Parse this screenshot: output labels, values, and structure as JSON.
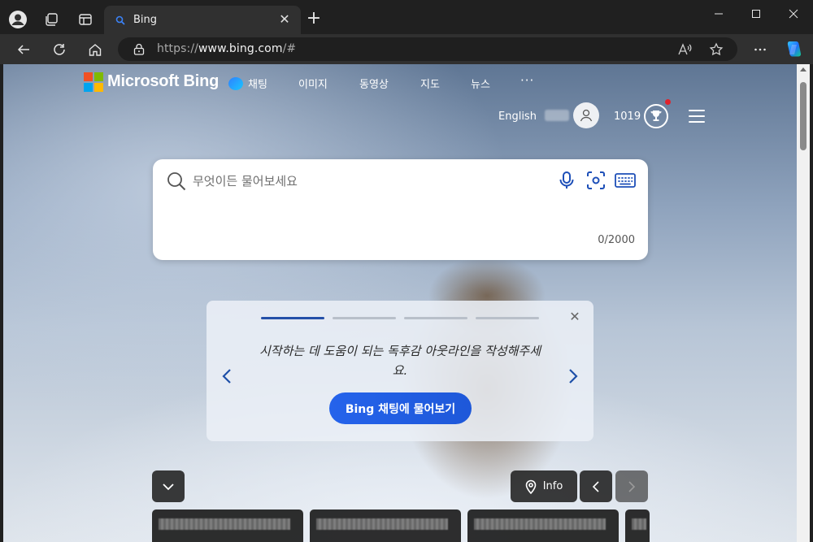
{
  "browser": {
    "tab": {
      "title": "Bing"
    },
    "address": {
      "scheme": "https://",
      "host": "www.bing.com",
      "path": "/#"
    }
  },
  "header": {
    "brand": "Microsoft Bing",
    "nav": [
      {
        "label": "채팅"
      },
      {
        "label": "이미지"
      },
      {
        "label": "동영상"
      },
      {
        "label": "지도"
      },
      {
        "label": "뉴스"
      },
      {
        "label": "···"
      }
    ],
    "language": "English",
    "rewards_points": "1019"
  },
  "search": {
    "placeholder": "무엇이든 물어보세요",
    "counter": "0/2000"
  },
  "outline_card": {
    "progress_active_index": 0,
    "progress_steps": 4,
    "message": "시작하는 데 도움이 되는 독후감 아웃라인을 작성해주세요.",
    "button_label": "Bing 채팅에 물어보기"
  },
  "bottom": {
    "info_label": "Info"
  },
  "colors": {
    "accent": "#2563eb",
    "logo": [
      "#f25022",
      "#7fba00",
      "#00a4ef",
      "#ffb900"
    ],
    "notification_dot": "#e0232c"
  },
  "icons": [
    "profile-icon",
    "workspaces-icon",
    "tab-actions-icon",
    "search-icon",
    "lock-icon",
    "read-aloud-icon",
    "favorite-star-icon",
    "more-icon",
    "copilot-icon",
    "microphone-icon",
    "visual-search-icon",
    "keyboard-icon",
    "location-pin-icon",
    "trophy-icon"
  ]
}
